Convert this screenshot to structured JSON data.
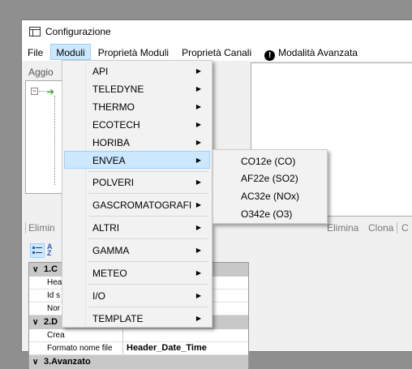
{
  "window": {
    "title": "Configurazione"
  },
  "menubar": {
    "items": [
      "File",
      "Moduli",
      "Proprietà Moduli",
      "Proprietà Canali",
      "Modalità Avanzata"
    ],
    "active_index": 1
  },
  "left_panel": {
    "toolbar_label": "Aggio"
  },
  "toolbar2": {
    "left_label": "Elimin",
    "elimina": "Elimina",
    "clona": "Clona",
    "cut": "C"
  },
  "properties": {
    "categories": [
      {
        "label": "1.C",
        "rows": [
          {
            "key": "Hea",
            "value": ""
          },
          {
            "key": "Id s",
            "value": ""
          },
          {
            "key": "Nor",
            "value": ""
          }
        ]
      },
      {
        "label": "2.D",
        "rows": [
          {
            "key": "Crea",
            "value": ""
          },
          {
            "key": "Formato nome file",
            "value": "Header_Date_Time"
          }
        ]
      },
      {
        "label": "3.Avanzato",
        "rows": []
      }
    ]
  },
  "moduli_menu": {
    "items": [
      {
        "label": "API"
      },
      {
        "label": "TELEDYNE"
      },
      {
        "label": "THERMO"
      },
      {
        "label": "ECOTECH"
      },
      {
        "label": "HORIBA"
      },
      {
        "label": "ENVEA",
        "highlighted": true
      },
      {
        "label": "POLVERI"
      },
      {
        "label": "GASCROMATOGRAFI"
      },
      {
        "label": "ALTRI"
      },
      {
        "label": "GAMMA"
      },
      {
        "label": "METEO"
      },
      {
        "label": "I/O"
      },
      {
        "label": "TEMPLATE"
      }
    ]
  },
  "envea_submenu": {
    "items": [
      "CO12e (CO)",
      "AF22e (SO2)",
      "AC32e (NOx)",
      "O342e (O3)"
    ]
  },
  "colors": {
    "highlight": "#cce8ff",
    "highlight_border": "#99d1ff",
    "tree_arrow": "#2fa82f"
  }
}
